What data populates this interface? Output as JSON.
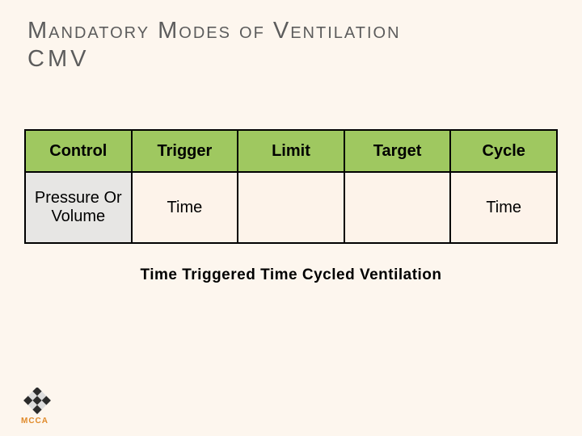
{
  "title": {
    "line1": "Mandatory Modes of Ventilation",
    "line2": "CMV"
  },
  "chart_data": {
    "type": "table",
    "headers": [
      "Control",
      "Trigger",
      "Limit",
      "Target",
      "Cycle"
    ],
    "rows": [
      {
        "control": "Pressure Or Volume",
        "trigger": "Time",
        "limit": "",
        "target": "",
        "cycle": "Time"
      }
    ]
  },
  "caption": "Time Triggered Time Cycled Ventilation",
  "logo": {
    "text": "MCCA"
  }
}
